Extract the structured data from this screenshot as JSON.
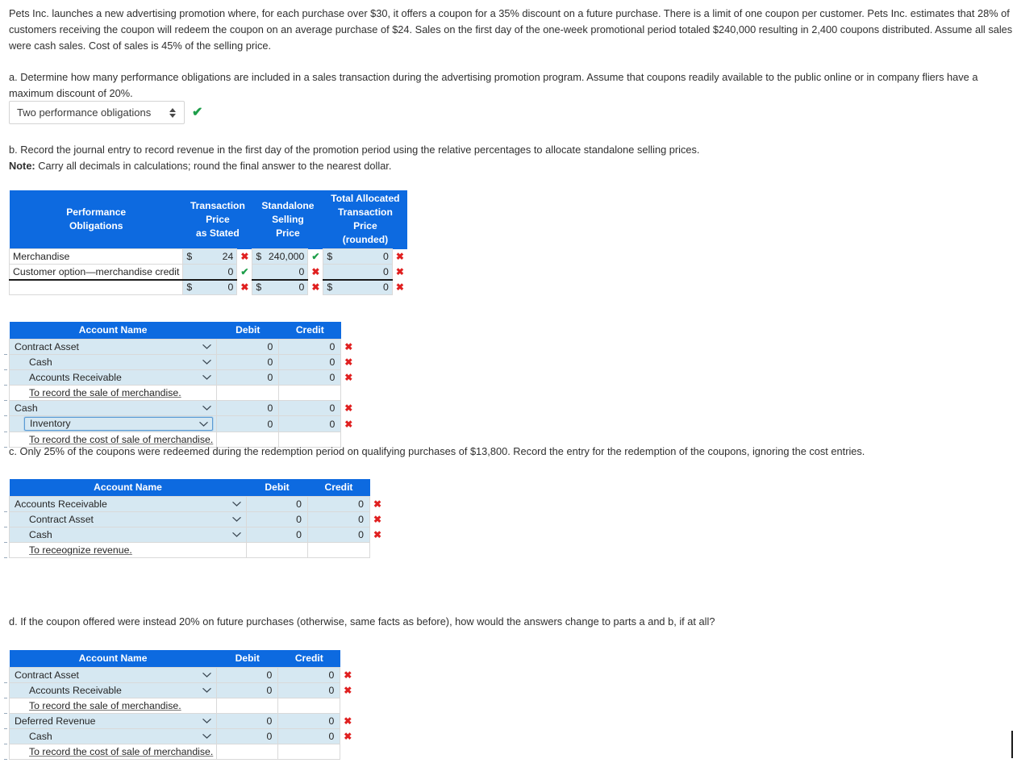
{
  "colors": {
    "header_blue": "#0d6ae0",
    "row_blue": "#d6e8f2",
    "mark_wrong": "#e02020",
    "mark_right": "#1e9e4a"
  },
  "prompt": {
    "paragraph": "Pets Inc. launches a new advertising promotion where, for each purchase over $30, it offers a coupon for a 35% discount on a future purchase. There is a limit of one coupon per customer. Pets Inc. estimates that 28% of customers receiving the coupon will redeem the coupon on an average purchase of $24. Sales on the first day of the one-week promotional period totaled $240,000 resulting in 2,400 coupons distributed. Assume all sales were cash sales. Cost of sales is 45% of the selling price."
  },
  "part_a": {
    "question": "a. Determine how many performance obligations are included in a sales transaction during the advertising promotion program. Assume that coupons readily available to the public online or in company fliers have a maximum discount of 20%.",
    "select_value": "Two performance obligations",
    "status_mark": "✔"
  },
  "part_b": {
    "question": "b. Record the journal entry to record revenue in the first day of the promotion period using the relative percentages to allocate standalone selling prices.",
    "note_label": "Note:",
    "note_text": " Carry all decimals in calculations; round the final answer to the nearest dollar.",
    "alloc_table": {
      "headers": {
        "col1": "Performance\nObligations",
        "col2": "Transaction\nPrice\nas Stated",
        "col3": "Standalone\nSelling\nPrice",
        "col4": "Total Allocated\nTransaction Price\n(rounded)"
      },
      "rows": [
        {
          "name": "Merchandise",
          "tp_dollar": "$",
          "tp_value": "24",
          "tp_mark": "✖",
          "tp_mark_state": "wrong",
          "ssp_dollar": "$",
          "ssp_value": "240,000",
          "ssp_mark": "✔",
          "ssp_mark_state": "right",
          "tot_dollar": "$",
          "tot_value": "0",
          "tot_mark": "✖",
          "tot_mark_state": "wrong"
        },
        {
          "name": "Customer option—merchandise credit",
          "tp_dollar": "",
          "tp_value": "0",
          "tp_mark": "✔",
          "tp_mark_state": "right",
          "ssp_dollar": "",
          "ssp_value": "0",
          "ssp_mark": "✖",
          "ssp_mark_state": "wrong",
          "tot_dollar": "",
          "tot_value": "0",
          "tot_mark": "✖",
          "tot_mark_state": "wrong"
        },
        {
          "name": "",
          "tp_dollar": "$",
          "tp_value": "0",
          "tp_mark": "✖",
          "tp_mark_state": "wrong",
          "ssp_dollar": "$",
          "ssp_value": "0",
          "ssp_mark": "✖",
          "ssp_mark_state": "wrong",
          "tot_dollar": "$",
          "tot_value": "0",
          "tot_mark": "✖",
          "tot_mark_state": "wrong"
        }
      ]
    },
    "journal": {
      "headers": {
        "account": "Account Name",
        "debit": "Debit",
        "credit": "Credit"
      },
      "rows": [
        {
          "kind": "account",
          "account": "Contract Asset",
          "indent": false,
          "debit": "0",
          "credit": "0",
          "mark": "✖",
          "focused": false
        },
        {
          "kind": "account",
          "account": "Cash",
          "indent": true,
          "debit": "0",
          "credit": "0",
          "mark": "✖",
          "focused": false
        },
        {
          "kind": "account",
          "account": "Accounts Receivable",
          "indent": true,
          "debit": "0",
          "credit": "0",
          "mark": "✖",
          "focused": false
        },
        {
          "kind": "memo",
          "account": "To record the sale of merchandise.",
          "debit": "",
          "credit": "",
          "mark": ""
        },
        {
          "kind": "account",
          "account": "Cash",
          "indent": false,
          "debit": "0",
          "credit": "0",
          "mark": "✖",
          "focused": false
        },
        {
          "kind": "account",
          "account": "Inventory",
          "indent": true,
          "debit": "0",
          "credit": "0",
          "mark": "✖",
          "focused": true
        },
        {
          "kind": "memo",
          "account": "To record the cost of sale of merchandise.",
          "debit": "",
          "credit": "",
          "mark": ""
        }
      ]
    }
  },
  "part_c": {
    "question": "c. Only 25% of the coupons were redeemed during the redemption period on qualifying purchases of $13,800. Record the entry for the redemption of the coupons, ignoring the cost entries.",
    "journal": {
      "headers": {
        "account": "Account Name",
        "debit": "Debit",
        "credit": "Credit"
      },
      "rows": [
        {
          "kind": "account",
          "account": "Accounts Receivable",
          "indent": false,
          "debit": "0",
          "credit": "0",
          "mark": "✖",
          "focused": false
        },
        {
          "kind": "account",
          "account": "Contract Asset",
          "indent": true,
          "debit": "0",
          "credit": "0",
          "mark": "✖",
          "focused": false
        },
        {
          "kind": "account",
          "account": "Cash",
          "indent": true,
          "debit": "0",
          "credit": "0",
          "mark": "✖",
          "focused": false
        },
        {
          "kind": "memo",
          "account": "To receognize revenue.",
          "debit": "",
          "credit": "",
          "mark": ""
        }
      ]
    }
  },
  "part_d": {
    "question": "d. If the coupon offered were instead 20% on future purchases (otherwise, same facts as before), how would the answers change to parts a and b, if at all?",
    "journal": {
      "headers": {
        "account": "Account Name",
        "debit": "Debit",
        "credit": "Credit"
      },
      "rows": [
        {
          "kind": "account",
          "account": "Contract Asset",
          "indent": false,
          "debit": "0",
          "credit": "0",
          "mark": "✖",
          "focused": false
        },
        {
          "kind": "account",
          "account": "Accounts Receivable",
          "indent": true,
          "debit": "0",
          "credit": "0",
          "mark": "✖",
          "focused": false
        },
        {
          "kind": "memo",
          "account": "To record the sale of merchandise.",
          "debit": "",
          "credit": "",
          "mark": ""
        },
        {
          "kind": "account",
          "account": "Deferred Revenue",
          "indent": false,
          "debit": "0",
          "credit": "0",
          "mark": "✖",
          "focused": false
        },
        {
          "kind": "account",
          "account": "Cash",
          "indent": true,
          "debit": "0",
          "credit": "0",
          "mark": "✖",
          "focused": false
        },
        {
          "kind": "memo",
          "account": "To record the cost of sale of merchandise.",
          "debit": "",
          "credit": "",
          "mark": ""
        }
      ]
    }
  }
}
